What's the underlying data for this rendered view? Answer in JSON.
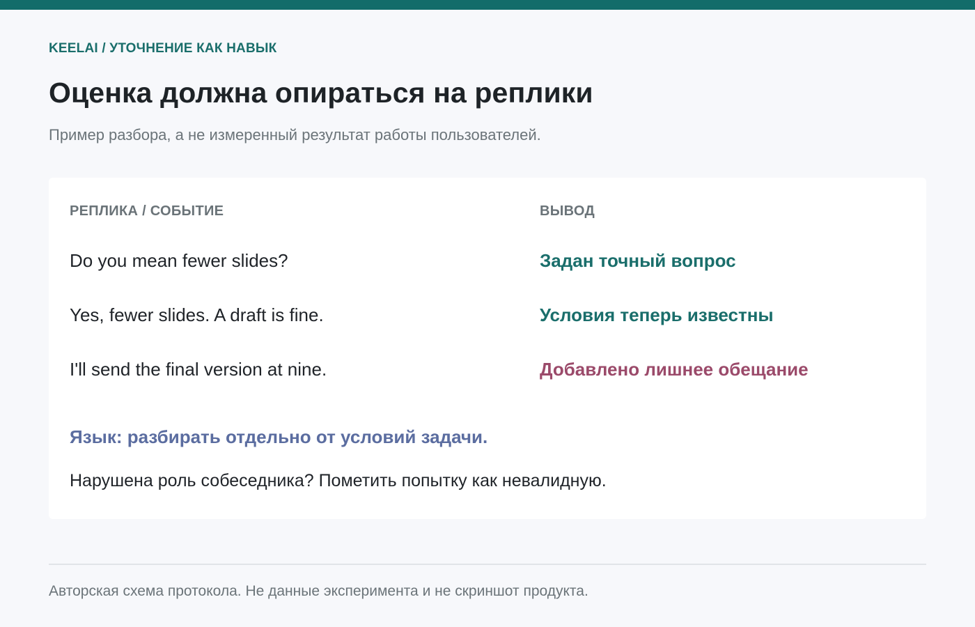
{
  "colors": {
    "accent": "#136c6a",
    "teal_text": "#1a6e6b",
    "warning": "#9b4a6a",
    "language": "#5b6da0"
  },
  "breadcrumb": "KEELAI / УТОЧНЕНИЕ КАК НАВЫК",
  "title": "Оценка должна опираться на реплики",
  "subtitle": "Пример разбора, а не измеренный результат работы пользователей.",
  "table": {
    "headers": {
      "left": "РЕПЛИКА / СОБЫТИЕ",
      "right": "ВЫВОД"
    },
    "rows": [
      {
        "utterance": "Do you mean fewer slides?",
        "conclusion": "Задан точный вопрос",
        "tone": "positive"
      },
      {
        "utterance": "Yes, fewer slides. A draft is fine.",
        "conclusion": "Условия теперь известны",
        "tone": "positive"
      },
      {
        "utterance": "I'll send the final version at nine.",
        "conclusion": "Добавлено лишнее обещание",
        "tone": "warning"
      }
    ]
  },
  "notes": {
    "language": "Язык: разбирать отдельно от условий задачи.",
    "role": "Нарушена роль собеседника? Пометить попытку как невалидную."
  },
  "footer": "Авторская схема протокола. Не данные эксперимента и не скриншот продукта."
}
